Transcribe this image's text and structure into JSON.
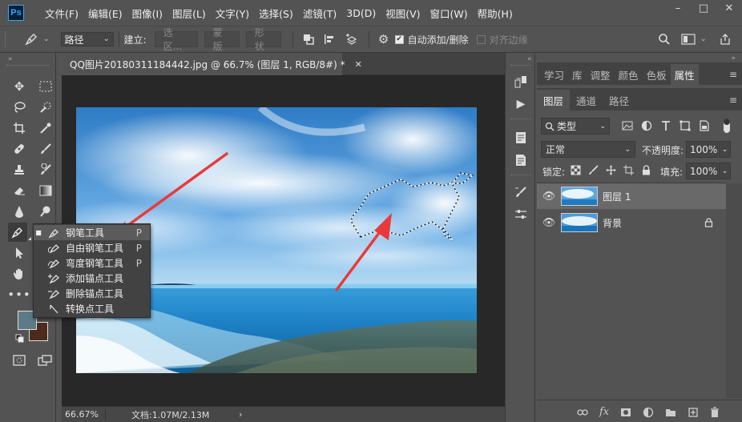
{
  "menubar": {
    "logo": "Ps",
    "items": [
      "文件(F)",
      "编辑(E)",
      "图像(I)",
      "图层(L)",
      "文字(Y)",
      "选择(S)",
      "滤镜(T)",
      "3D(D)",
      "视图(V)",
      "窗口(W)",
      "帮助(H)"
    ],
    "window_controls": [
      "–",
      "□",
      "✕"
    ]
  },
  "options": {
    "mode_select": "路径",
    "make_label": "建立:",
    "selection_btn": "选区...",
    "mask_btn": "蒙版",
    "shape_btn": "形状",
    "auto_add_delete_label": "自动添加/删除",
    "align_edges_label": "对齐边缘"
  },
  "toolbar": {
    "flyout": [
      {
        "label": "钢笔工具",
        "key": "P",
        "selected": true
      },
      {
        "label": "自由钢笔工具",
        "key": "P",
        "selected": false
      },
      {
        "label": "弯度钢笔工具",
        "key": "P",
        "selected": false
      },
      {
        "label": "添加锚点工具",
        "key": "",
        "selected": false
      },
      {
        "label": "删除锚点工具",
        "key": "",
        "selected": false
      },
      {
        "label": "转换点工具",
        "key": "",
        "selected": false
      }
    ],
    "foreground_color": "#5e7a88",
    "background_color": "#4e2a1c"
  },
  "document": {
    "tab_title": "QQ图片20180311184442.jpg @ 66.7% (图层 1, RGB/8#) *",
    "close": "✕",
    "status_zoom": "66.67%",
    "status_doc": "文档:1.07M/2.13M",
    "status_arrow": "›"
  },
  "panels": {
    "top_tabs": [
      "学习",
      "库",
      "调整",
      "颜色",
      "色板",
      "属性"
    ],
    "active_top_tab": "属性",
    "layer_tabs": [
      "图层",
      "通道",
      "路径"
    ],
    "active_layer_tab": "图层",
    "filter_kind": "类型",
    "blend_mode": "正常",
    "opacity_label": "不透明度:",
    "opacity_value": "100%",
    "lock_label": "锁定:",
    "fill_label": "填充:",
    "fill_value": "100%",
    "layers": [
      {
        "name": "图层 1",
        "active": true,
        "locked": false
      },
      {
        "name": "背景",
        "active": false,
        "locked": true
      }
    ]
  },
  "colors": {
    "accent_arrow": "#e83a3a",
    "ui_bg": "#535353"
  }
}
